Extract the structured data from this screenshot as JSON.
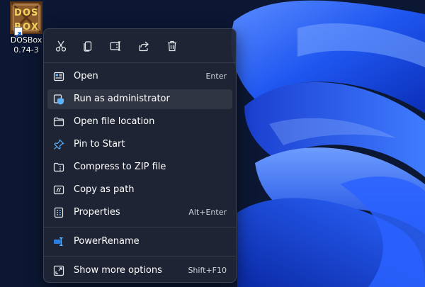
{
  "desktop": {
    "icon": {
      "name": "DOSBox 0.74-3",
      "logo_text": "DOS BOX",
      "letters": [
        "D",
        "O",
        "S",
        "B",
        "O",
        "X"
      ]
    }
  },
  "context_menu": {
    "toolbar": [
      {
        "name": "cut-icon",
        "label": "Cut"
      },
      {
        "name": "copy-icon",
        "label": "Copy"
      },
      {
        "name": "rename-icon",
        "label": "Rename"
      },
      {
        "name": "share-icon",
        "label": "Share"
      },
      {
        "name": "delete-icon",
        "label": "Delete"
      }
    ],
    "items": [
      {
        "label": "Open",
        "shortcut": "Enter",
        "icon": "open-icon"
      },
      {
        "label": "Run as administrator",
        "shortcut": "",
        "icon": "shield-icon",
        "highlighted": true
      },
      {
        "label": "Open file location",
        "shortcut": "",
        "icon": "folder-icon"
      },
      {
        "label": "Pin to Start",
        "shortcut": "",
        "icon": "pin-icon"
      },
      {
        "label": "Compress to ZIP file",
        "shortcut": "",
        "icon": "zip-icon"
      },
      {
        "label": "Copy as path",
        "shortcut": "",
        "icon": "path-icon"
      },
      {
        "label": "Properties",
        "shortcut": "Alt+Enter",
        "icon": "properties-icon"
      }
    ],
    "power_items": [
      {
        "label": "PowerRename",
        "icon": "powerrename-icon"
      }
    ],
    "more": {
      "label": "Show more options",
      "shortcut": "Shift+F10",
      "icon": "more-options-icon"
    }
  },
  "colors": {
    "wallpaper_bg": "#0b1733",
    "bloom_blue": "#1f56f0",
    "menu_bg": "#202634",
    "text": "#ffffff",
    "shortcut_text": "#cfd3da",
    "accent_icon": "#5cb3ff"
  }
}
